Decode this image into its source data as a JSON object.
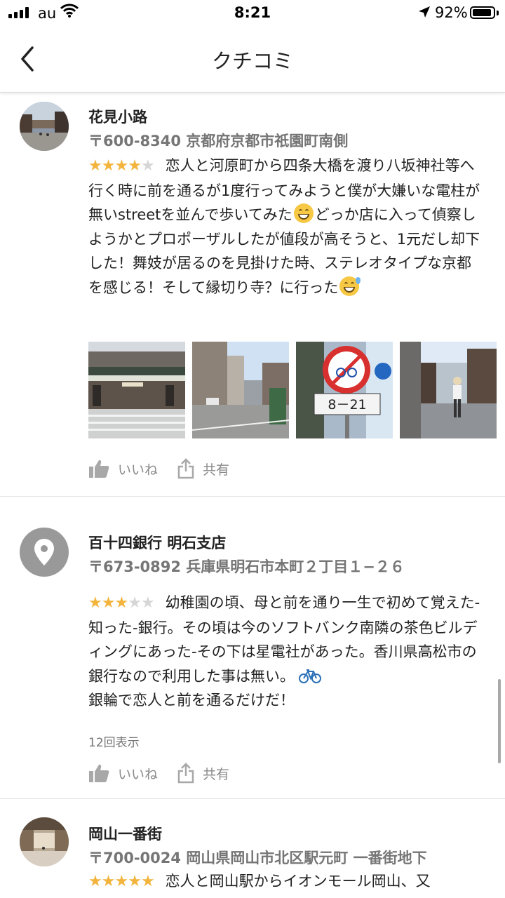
{
  "status_bar": {
    "carrier": "au",
    "time": "8:21",
    "battery_percent": "92%",
    "battery_level": 0.92,
    "signal_icon": "signal-bars-icon",
    "wifi_icon": "wifi-icon",
    "location_icon": "location-arrow-icon"
  },
  "nav": {
    "title": "クチコミ",
    "back_icon": "chevron-left-icon"
  },
  "colors": {
    "star_on": "#f2b43c",
    "star_off": "#d6d6d6",
    "secondary_text": "#757575"
  },
  "reviews": [
    {
      "place_name": "花見小路",
      "address": "〒600-8340 京都府京都市祇園町南側",
      "rating": 4,
      "text_part1": "恋人と河原町から四条大橋を渡り八坂神社等へ行く時に前を通るが1度行ってみようと僕が大嫌いな電柱が無いstreetを並んで歩いてみた",
      "text_part2": "どっか店に入って偵察しようかとプロポーザルしたが値段が高そうと、1元だし却下した！舞妓が居るのを見掛けた時、ステレオタイプな京都を感じる！そして縁切り寺？に行った",
      "photos": [
        "storefront-photo",
        "street-photo",
        "road-sign-photo",
        "alley-photo"
      ],
      "like_label": "いいね",
      "share_label": "共有"
    },
    {
      "place_name": "百十四銀行 明石支店",
      "address": "〒673-0892 兵庫県明石市本町２丁目１−２６",
      "rating": 3,
      "text": "幼稚園の頃、母と前を通り一生で初めて覚えた-知った-銀行。その頃は今のソフトバンク南隣の茶色ビルディングにあった-その下は星電社があった。香川県高松市の銀行なので利用した事は無い。",
      "text_after_icon": "銀輪で恋人と前を通るだけだ！",
      "views": "12回表示",
      "like_label": "いいね",
      "share_label": "共有"
    },
    {
      "place_name": "岡山一番街",
      "address": "〒700-0024 岡山県岡山市北区駅元町 一番街地下",
      "rating": 5,
      "text": "恋人と岡山駅からイオンモール岡山、又"
    }
  ]
}
